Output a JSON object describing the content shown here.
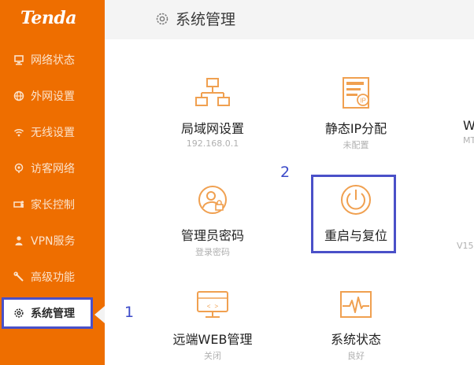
{
  "brand": "Tenda",
  "header": {
    "title": "系统管理"
  },
  "sidebar": {
    "items": [
      {
        "label": "网络状态",
        "icon": "network-status-icon"
      },
      {
        "label": "外网设置",
        "icon": "globe-icon"
      },
      {
        "label": "无线设置",
        "icon": "wifi-icon"
      },
      {
        "label": "访客网络",
        "icon": "guest-network-icon"
      },
      {
        "label": "家长控制",
        "icon": "parental-control-icon"
      },
      {
        "label": "VPN服务",
        "icon": "vpn-icon"
      },
      {
        "label": "高级功能",
        "icon": "tools-icon"
      },
      {
        "label": "系统管理",
        "icon": "gear-icon",
        "active": true
      }
    ]
  },
  "tiles": [
    {
      "label": "局域网设置",
      "sub": "192.168.0.1",
      "icon": "lan-topology-icon"
    },
    {
      "label": "静态IP分配",
      "sub": "未配置",
      "icon": "static-ip-icon"
    },
    {
      "label": "管理员密码",
      "sub": "登录密码",
      "icon": "admin-password-icon"
    },
    {
      "label": "重启与复位",
      "sub": "",
      "icon": "power-icon"
    },
    {
      "label": "远端WEB管理",
      "sub": "关闭",
      "icon": "remote-web-icon"
    },
    {
      "label": "系统状态",
      "sub": "良好",
      "icon": "system-status-icon"
    }
  ],
  "partial": {
    "w_label": "W",
    "mt_label": "MT",
    "v15_label": "V15"
  },
  "annotations": {
    "step1": "1",
    "step2": "2"
  },
  "colors": {
    "sidebar": "#ee6e00",
    "accent": "#f08a30",
    "highlight": "#4a50c8"
  }
}
